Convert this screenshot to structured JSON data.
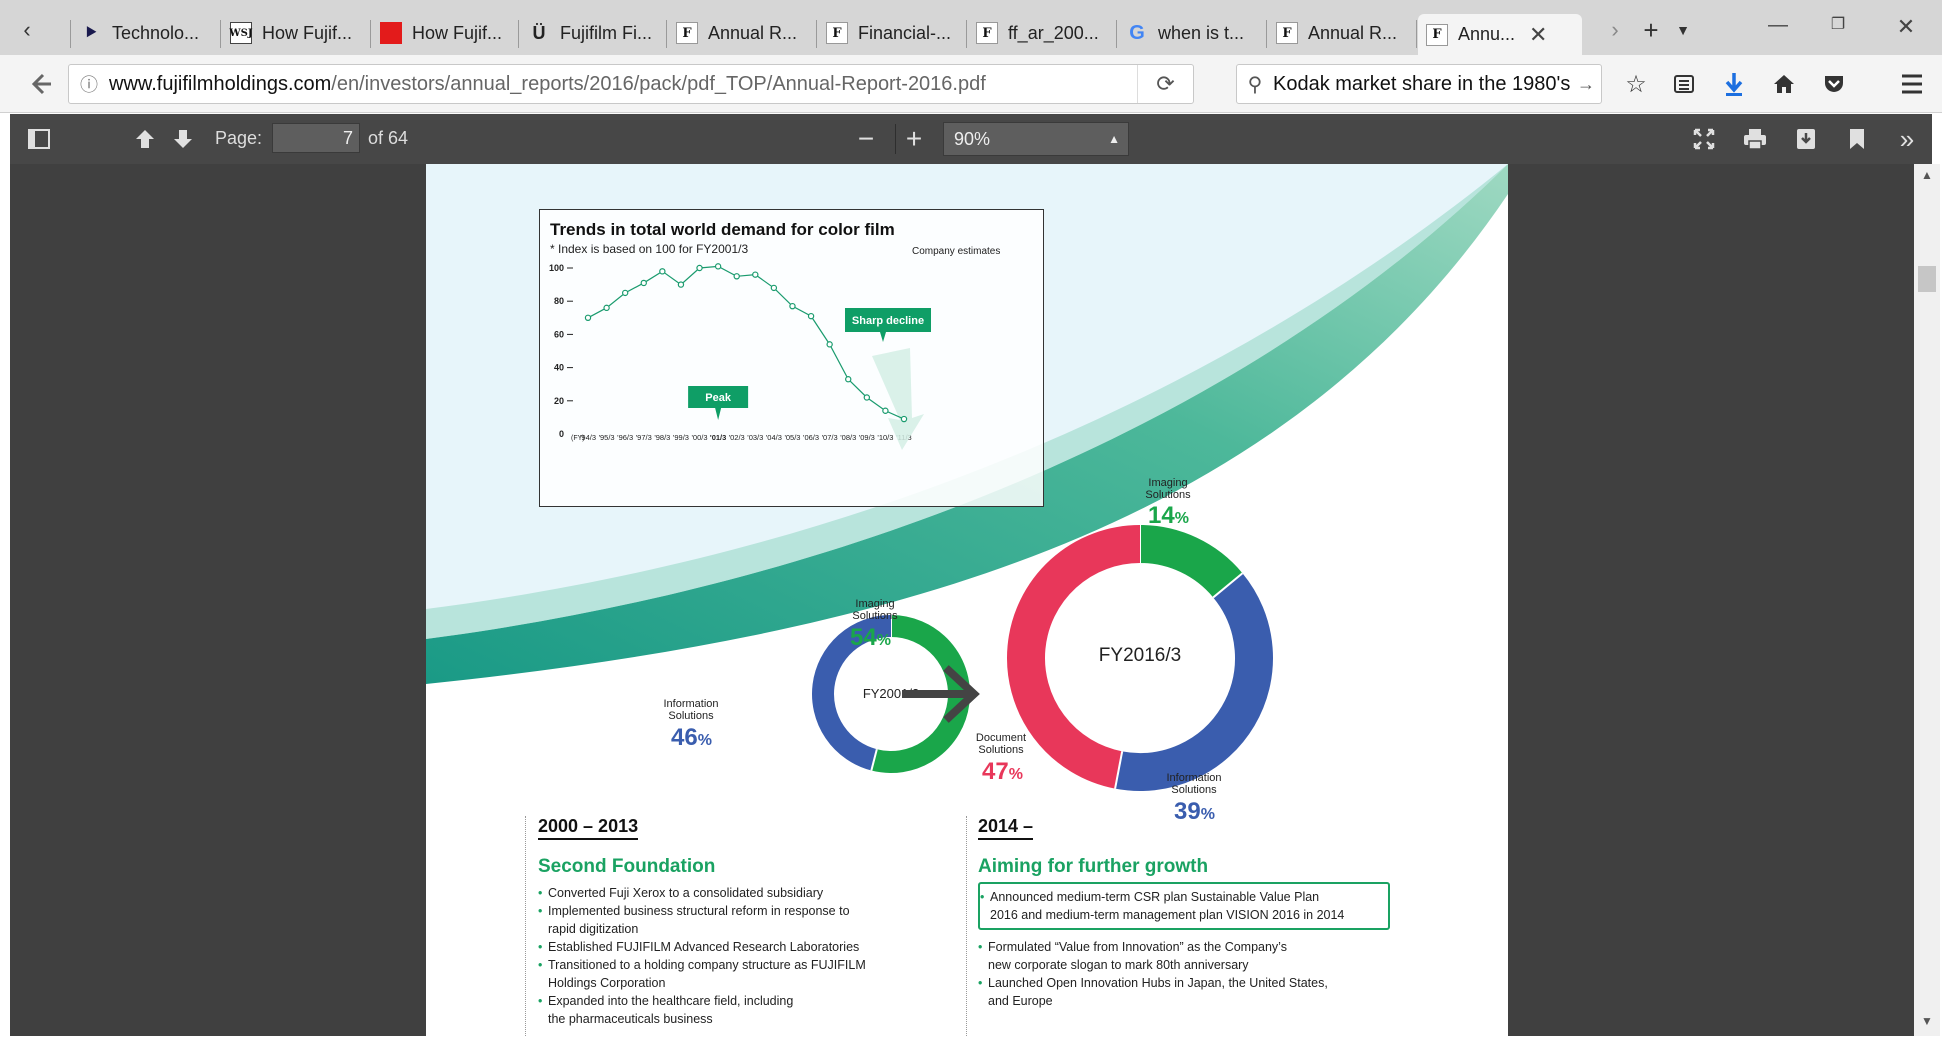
{
  "browser": {
    "tabs": [
      {
        "label": "Technolo...",
        "icon": "triangle-flag-icon"
      },
      {
        "label": "How Fujif...",
        "icon": "wsj-icon"
      },
      {
        "label": "How Fujif...",
        "icon": "red-square-icon"
      },
      {
        "label": "Fujifilm Fi...",
        "icon": "horseshoe-icon"
      },
      {
        "label": "Annual R...",
        "icon": "fujifilm-f-icon"
      },
      {
        "label": "Financial-...",
        "icon": "fujifilm-f-icon"
      },
      {
        "label": "ff_ar_200...",
        "icon": "fujifilm-f-icon"
      },
      {
        "label": "when is t...",
        "icon": "google-g-icon"
      },
      {
        "label": "Annual R...",
        "icon": "fujifilm-f-icon"
      },
      {
        "label": "Annu...",
        "icon": "fujifilm-f-icon",
        "active": true
      }
    ],
    "url_domain": "www.fujifilmholdings.com",
    "url_path": "/en/investors/annual_reports/2016/pack/pdf_TOP/Annual-Report-2016.pdf",
    "search_query": "Kodak market share in the 1980's"
  },
  "pdf_toolbar": {
    "page_label": "Page:",
    "page_number": "7",
    "page_of": "of 64",
    "zoom": "90%"
  },
  "chart_data": {
    "type": "line",
    "title": "Trends in total world demand for color film",
    "subtitle": "* Index is based on 100 for FY2001/3",
    "note": "Company estimates",
    "x_prefix": "(FY)",
    "categories": [
      "'94/3",
      "'95/3",
      "'96/3",
      "'97/3",
      "'98/3",
      "'99/3",
      "'00/3",
      "'01/3",
      "'02/3",
      "'03/3",
      "'04/3",
      "'05/3",
      "'06/3",
      "'07/3",
      "'08/3",
      "'09/3",
      "'10/3",
      "'11/3"
    ],
    "values": [
      70,
      76,
      85,
      91,
      98,
      90,
      100,
      101,
      95,
      96,
      88,
      77,
      71,
      54,
      33,
      22,
      14,
      9
    ],
    "yticks": [
      "100",
      "80",
      "60",
      "40",
      "20",
      "0"
    ],
    "ylim": [
      0,
      100
    ],
    "highlight_category": "'01/3",
    "annotations": {
      "peak": "Peak",
      "decline": "Sharp decline"
    },
    "colors": {
      "line": "#1a9b6e",
      "callout": "#0f9e66"
    }
  },
  "donut_2001": {
    "center": "FY2001/3",
    "segments": [
      {
        "label": "Imaging Solutions",
        "label_lines": [
          "Imaging",
          "Solutions"
        ],
        "pct": "54",
        "value": 54,
        "color": "#1aa64a"
      },
      {
        "label": "Information Solutions",
        "label_lines": [
          "Information",
          "Solutions"
        ],
        "pct": "46",
        "value": 46,
        "color": "#3a5dae"
      }
    ]
  },
  "donut_2016": {
    "center": "FY2016/3",
    "segments": [
      {
        "label": "Imaging Solutions",
        "label_lines": [
          "Imaging",
          "Solutions"
        ],
        "pct": "14",
        "value": 14,
        "color": "#1aa64a"
      },
      {
        "label": "Information Solutions",
        "label_lines": [
          "Information",
          "Solutions"
        ],
        "pct": "39",
        "value": 39,
        "color": "#3a5dae"
      },
      {
        "label": "Document Solutions",
        "label_lines": [
          "Document",
          "Solutions"
        ],
        "pct": "47",
        "value": 47,
        "color": "#e8375a"
      }
    ]
  },
  "pct_suffix": "%",
  "section_2000": {
    "years": "2000 – 2013",
    "heading": "Second Foundation",
    "bullets": [
      [
        "Converted Fuji Xerox to a consolidated subsidiary"
      ],
      [
        "Implemented business structural reform in response to",
        "rapid digitization"
      ],
      [
        "Established FUJIFILM Advanced Research Laboratories"
      ],
      [
        "Transitioned to a holding company structure as FUJIFILM",
        "Holdings Corporation"
      ],
      [
        "Expanded into the healthcare field, including",
        "the pharmaceuticals business"
      ]
    ]
  },
  "section_2014": {
    "years": "2014 –",
    "heading": "Aiming for further growth",
    "highlight": [
      "Announced medium-term CSR plan Sustainable Value Plan",
      "2016 and medium-term management plan VISION 2016 in 2014"
    ],
    "bullets": [
      [
        "Formulated “Value from Innovation” as the Company’s",
        "new corporate slogan to mark 80th anniversary"
      ],
      [
        "Launched Open Innovation Hubs in Japan, the United States,",
        "and Europe"
      ]
    ]
  }
}
